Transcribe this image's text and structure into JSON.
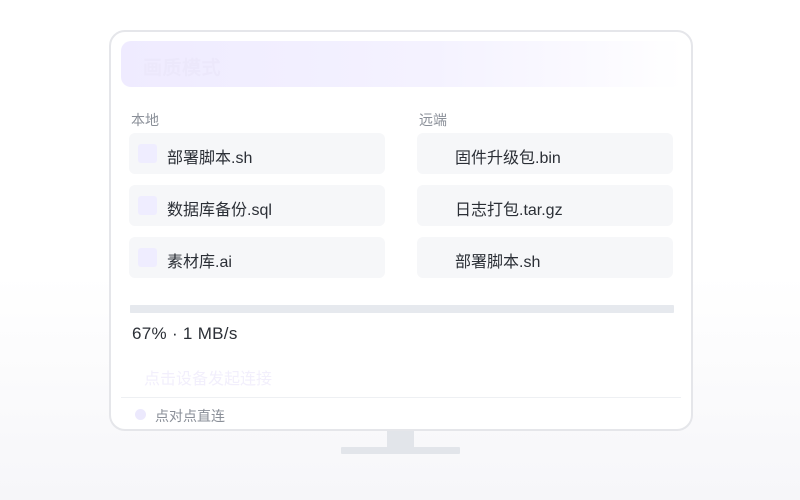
{
  "header": {
    "title": "画质模式"
  },
  "local": {
    "label": "本地",
    "files": [
      {
        "name": "部署脚本.sh",
        "icon": "file-icon"
      },
      {
        "name": "数据库备份.sql",
        "icon": "file-icon"
      },
      {
        "name": "素材库.ai",
        "icon": "file-icon"
      }
    ]
  },
  "remote": {
    "label": "远端",
    "files": [
      {
        "name": "固件升级包.bin"
      },
      {
        "name": "日志打包.tar.gz"
      },
      {
        "name": "部署脚本.sh"
      }
    ]
  },
  "transfer": {
    "percent": 67,
    "text": "67% · 1 MB/s"
  },
  "connect_link": "点击设备发起连接",
  "status": {
    "text": "点对点直连",
    "dot_color": "#ece9fd"
  },
  "colors": {
    "accent_light": "#efebff",
    "text_primary": "#2b2f36",
    "text_secondary": "#8a8f98"
  }
}
